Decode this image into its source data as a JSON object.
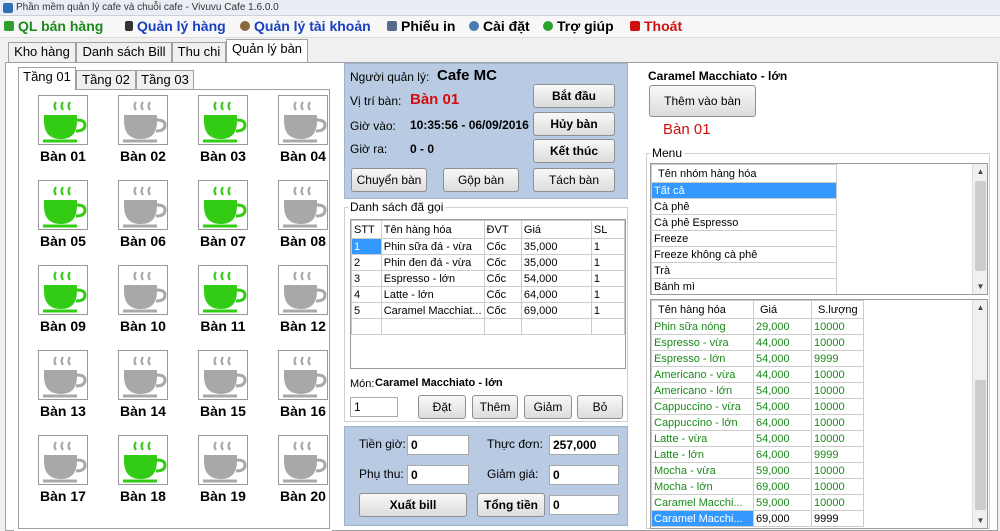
{
  "window": {
    "title": "Phần mềm quản lý cafe và chuỗi cafe - Vivuvu Cafe 1.6.0.0"
  },
  "menu": [
    {
      "label": "QL bán hàng",
      "color": "#1a8a1a"
    },
    {
      "label": "Quản lý hàng",
      "color": "#1a3fc0"
    },
    {
      "label": "Quản lý tài khoản",
      "color": "#1a3fc0"
    },
    {
      "label": "Phiếu in",
      "color": "#000000"
    },
    {
      "label": "Cài đặt",
      "color": "#000000"
    },
    {
      "label": "Trợ giúp",
      "color": "#000000"
    },
    {
      "label": "Thoát",
      "color": "#d01010"
    }
  ],
  "tabs": [
    "Kho hàng",
    "Danh sách Bill",
    "Thu chi",
    "Quản lý bàn"
  ],
  "floors": [
    "Tầng 01",
    "Tầng 02",
    "Tầng 03"
  ],
  "tables": [
    {
      "name": "Bàn 01",
      "occupied": true
    },
    {
      "name": "Bàn 02",
      "occupied": false
    },
    {
      "name": "Bàn 03",
      "occupied": true
    },
    {
      "name": "Bàn 04",
      "occupied": false
    },
    {
      "name": "Bàn 05",
      "occupied": true
    },
    {
      "name": "Bàn 06",
      "occupied": false
    },
    {
      "name": "Bàn 07",
      "occupied": true
    },
    {
      "name": "Bàn 08",
      "occupied": false
    },
    {
      "name": "Bàn 09",
      "occupied": true
    },
    {
      "name": "Bàn 10",
      "occupied": false
    },
    {
      "name": "Bàn 11",
      "occupied": true
    },
    {
      "name": "Bàn 12",
      "occupied": false
    },
    {
      "name": "Bàn 13",
      "occupied": false
    },
    {
      "name": "Bàn 14",
      "occupied": false
    },
    {
      "name": "Bàn 15",
      "occupied": false
    },
    {
      "name": "Bàn 16",
      "occupied": false
    },
    {
      "name": "Bàn 17",
      "occupied": false
    },
    {
      "name": "Bàn 18",
      "occupied": true
    },
    {
      "name": "Bàn 19",
      "occupied": false
    },
    {
      "name": "Bàn 20",
      "occupied": false
    }
  ],
  "colors": {
    "occupied": "#33cc14",
    "empty": "#a8a8a8",
    "accent": "#d01010",
    "selection": "#3399ff"
  },
  "info": {
    "manager_label": "Người quản lý:",
    "manager_value": "Cafe MC",
    "position_label": "Vị trí bàn:",
    "position_value": "Bàn 01",
    "time_in_label": "Giờ vào:",
    "time_in_value": "10:35:56 - 06/09/2016",
    "time_out_label": "Giờ ra:",
    "time_out_value": "0 - 0",
    "btn_start": "Bắt đầu",
    "btn_cancel": "Hủy bàn",
    "btn_end": "Kết thúc",
    "btn_move": "Chuyển bàn",
    "btn_merge": "Gộp bàn",
    "btn_split": "Tách bàn"
  },
  "ordered": {
    "title": "Danh sách đã gọi",
    "columns": [
      "STT",
      "Tên hàng hóa",
      "ĐVT",
      "Giá",
      "SL"
    ],
    "rows": [
      [
        "1",
        "Phin sữa đá - vừa",
        "Cốc",
        "35,000",
        "1"
      ],
      [
        "2",
        "Phin đen đá - vừa",
        "Cốc",
        "35,000",
        "1"
      ],
      [
        "3",
        "Espresso - lớn",
        "Cốc",
        "54,000",
        "1"
      ],
      [
        "4",
        "Latte - lớn",
        "Cốc",
        "64,000",
        "1"
      ],
      [
        "5",
        "Caramel Macchiat...",
        "Cốc",
        "69,000",
        "1"
      ]
    ]
  },
  "item": {
    "label": "Món:",
    "value": "Caramel Macchiato - lớn",
    "qty": "1",
    "btn_order": "Đặt",
    "btn_add": "Thêm",
    "btn_reduce": "Giảm",
    "btn_remove": "Bỏ"
  },
  "totals": {
    "hour_fee_label": "Tiền giờ:",
    "hour_fee": "0",
    "menu_label": "Thực đơn:",
    "menu_total": "257,000",
    "extra_label": "Phụ thu:",
    "extra": "0",
    "discount_label": "Giảm giá:",
    "discount": "0",
    "btn_bill": "Xuất bill",
    "btn_total": "Tổng tiền",
    "total": "0"
  },
  "right": {
    "selected_item": "Caramel Macchiato - lớn",
    "btn_add_to_table": "Thêm vào bàn",
    "table_name": "Bàn 01",
    "menu_title": "Menu",
    "groups_header": "Tên nhóm hàng hóa",
    "groups": [
      "Tất cả",
      "Cà phê",
      "Cà phê Espresso",
      "Freeze",
      "Freeze không cà phê",
      "Trà",
      "Bánh mì"
    ],
    "goods_columns": [
      "Tên hàng hóa",
      "Giá",
      "S.lượng"
    ],
    "goods": [
      [
        "Phin sữa nóng",
        "29,000",
        "10000"
      ],
      [
        "Espresso - vừa",
        "44,000",
        "10000"
      ],
      [
        "Espresso - lớn",
        "54,000",
        "9999"
      ],
      [
        "Americano - vừa",
        "44,000",
        "10000"
      ],
      [
        "Americano - lớn",
        "54,000",
        "10000"
      ],
      [
        "Cappuccino - vừa",
        "54,000",
        "10000"
      ],
      [
        "Cappuccino - lớn",
        "64,000",
        "10000"
      ],
      [
        "Latte - vừa",
        "54,000",
        "10000"
      ],
      [
        "Latte - lớn",
        "64,000",
        "9999"
      ],
      [
        "Mocha - vừa",
        "59,000",
        "10000"
      ],
      [
        "Mocha - lớn",
        "69,000",
        "10000"
      ],
      [
        "Caramel Macchi...",
        "59,000",
        "10000"
      ],
      [
        "Caramel Macchi...",
        "69,000",
        "9999"
      ]
    ]
  }
}
